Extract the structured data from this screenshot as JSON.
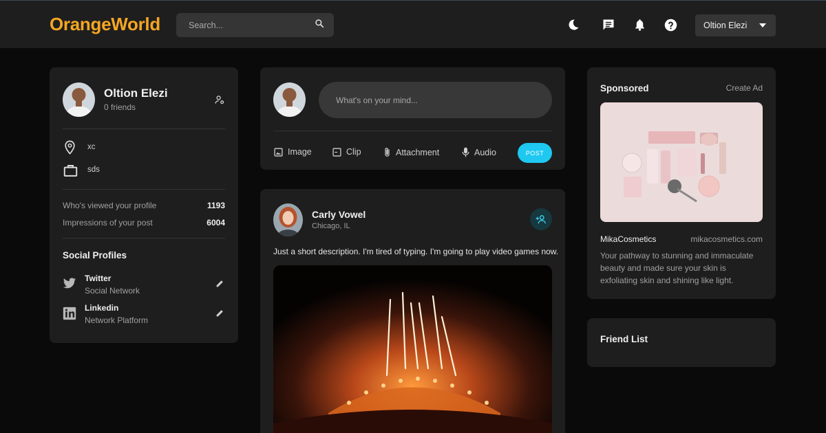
{
  "header": {
    "logo": "OrangeWorld",
    "search_placeholder": "Search...",
    "user_name": "Oltion Elezi",
    "icons": [
      "moon-icon",
      "chat-icon",
      "bell-icon",
      "help-icon",
      "search-icon",
      "caret-down-icon"
    ]
  },
  "profile": {
    "name": "Oltion Elezi",
    "friends": "0 friends",
    "location": "xc",
    "work": "sds",
    "stats": [
      {
        "label": "Who's viewed your profile",
        "value": "1193"
      },
      {
        "label": "Impressions of your post",
        "value": "6004"
      }
    ],
    "social_title": "Social Profiles",
    "socials": [
      {
        "name": "Twitter",
        "sub": "Social Network"
      },
      {
        "name": "Linkedin",
        "sub": "Network Platform"
      }
    ]
  },
  "composer": {
    "placeholder": "What's on your mind...",
    "tools": [
      "Image",
      "Clip",
      "Attachment",
      "Audio"
    ],
    "post_label": "POST"
  },
  "post": {
    "author": "Carly Vowel",
    "location": "Chicago, IL",
    "text": "Just a short description. I'm tired of typing. I'm going to play video games now."
  },
  "sponsored": {
    "title": "Sponsored",
    "create_ad": "Create Ad",
    "brand": "MikaCosmetics",
    "url": "mikacosmetics.com",
    "description": "Your pathway to stunning and immaculate beauty and made sure your skin is exfoliating skin and shining like light."
  },
  "friend_list": {
    "title": "Friend List"
  },
  "colors": {
    "accent_orange": "#f5a623",
    "post_button": "#1ec8f0",
    "card_bg": "#1e1e1e",
    "page_bg": "#0a0a0a"
  }
}
